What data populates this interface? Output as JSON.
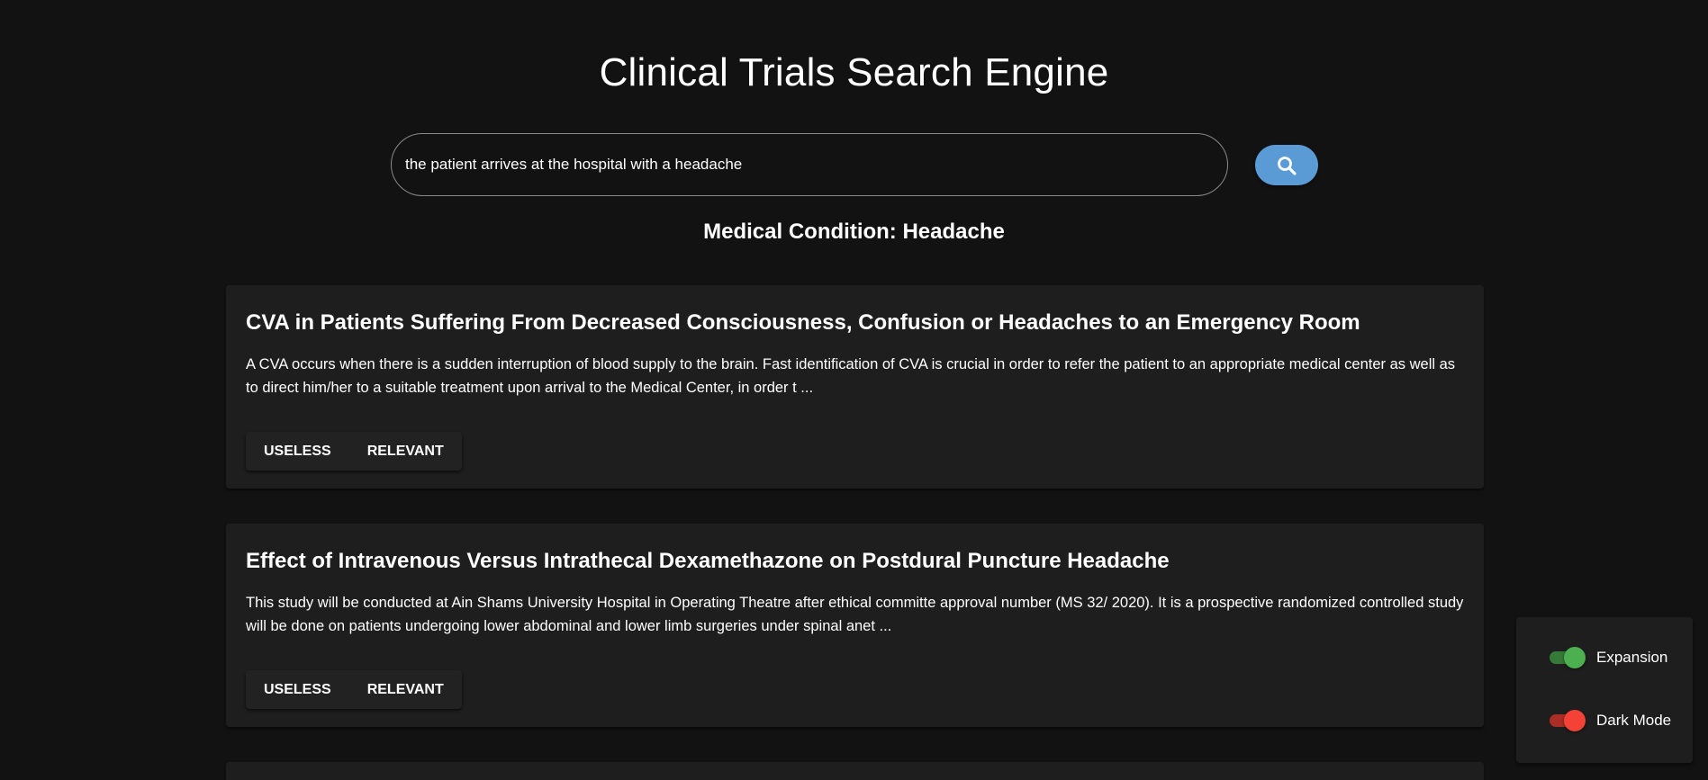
{
  "header": {
    "title": "Clinical Trials Search Engine"
  },
  "search": {
    "value": "the patient arrives at the hospital with a headache",
    "button_icon": "search-icon"
  },
  "condition": {
    "text": "Medical Condition: Headache"
  },
  "results": [
    {
      "title": "CVA in Patients Suffering From Decreased Consciousness, Confusion or Headaches to an Emergency Room",
      "description": "A CVA occurs when there is a sudden interruption of blood supply to the brain. Fast identification of CVA is crucial in order to refer the patient to an appropriate medical center as well as to direct him/her to a suitable treatment upon arrival to the Medical Center, in order t ...",
      "useless_label": "USELESS",
      "relevant_label": "RELEVANT"
    },
    {
      "title": "Effect of Intravenous Versus Intrathecal Dexamethazone on Postdural Puncture Headache",
      "description": "This study will be conducted at Ain Shams University Hospital in Operating Theatre after ethical committe approval number (MS 32/ 2020). It is a prospective randomized controlled study will be done on patients undergoing lower abdominal and lower limb surgeries under spinal anet ...",
      "useless_label": "USELESS",
      "relevant_label": "RELEVANT"
    }
  ],
  "settings": {
    "expansion": {
      "label": "Expansion",
      "on": true,
      "color": "#4caf50",
      "track_color": "#357a38"
    },
    "dark_mode": {
      "label": "Dark Mode",
      "on": true,
      "color": "#f44336",
      "track_color": "#aa2e25"
    }
  },
  "colors": {
    "background": "#121212",
    "card": "#1e1e1e",
    "accent": "#5b9bd5"
  }
}
